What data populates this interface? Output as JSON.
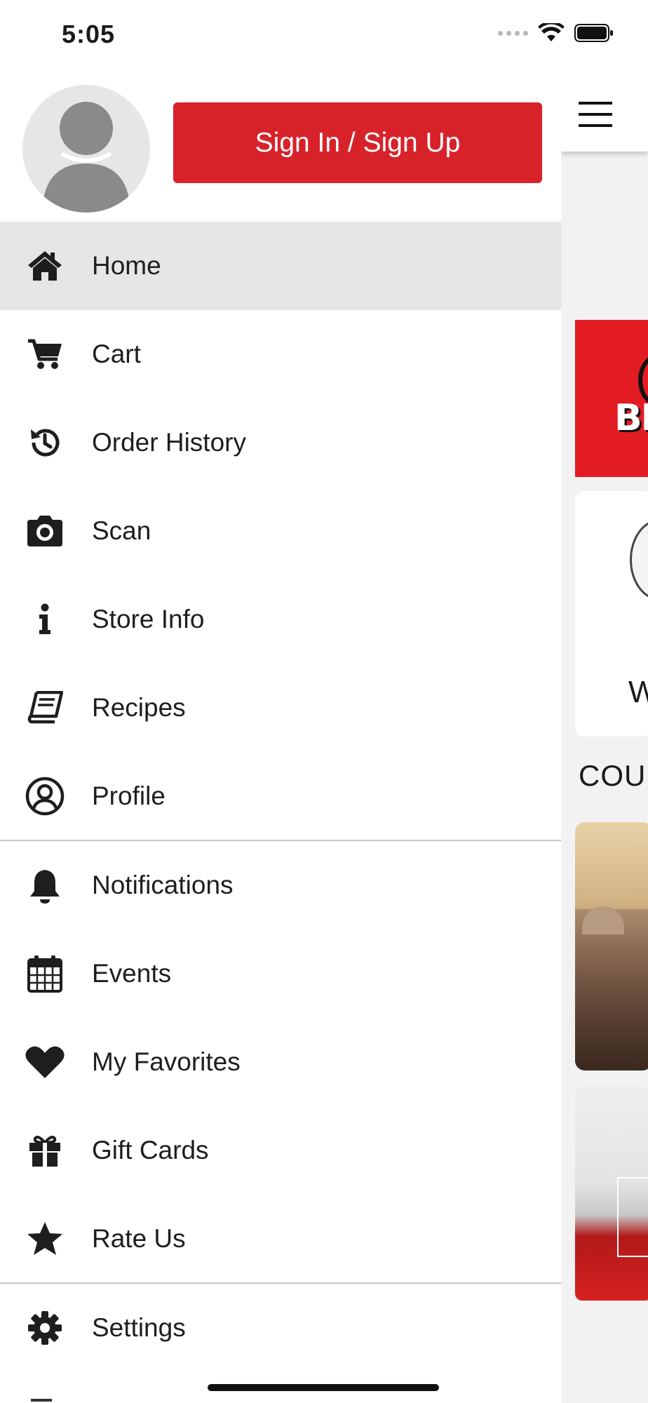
{
  "status_bar": {
    "time": "5:05"
  },
  "drawer": {
    "sign_in_label": "Sign In / Sign Up",
    "menu": [
      {
        "label": "Home",
        "icon": "home-icon",
        "active": true
      },
      {
        "label": "Cart",
        "icon": "cart-icon"
      },
      {
        "label": "Order History",
        "icon": "history-icon"
      },
      {
        "label": "Scan",
        "icon": "camera-icon"
      },
      {
        "label": "Store Info",
        "icon": "info-icon"
      },
      {
        "label": "Recipes",
        "icon": "book-icon"
      },
      {
        "label": "Profile",
        "icon": "user-circle-icon"
      },
      {
        "label": "Notifications",
        "icon": "bell-icon"
      },
      {
        "label": "Events",
        "icon": "calendar-icon"
      },
      {
        "label": "My Favorites",
        "icon": "heart-icon"
      },
      {
        "label": "Gift Cards",
        "icon": "gift-icon"
      },
      {
        "label": "Rate Us",
        "icon": "star-icon"
      },
      {
        "label": "Settings",
        "icon": "gear-icon"
      }
    ]
  },
  "main": {
    "promo_text": "BE",
    "welcome_letter": "W",
    "section_title": "COU"
  },
  "colors": {
    "accent": "#d8222a",
    "active_row": "#e6e6e6",
    "icon": "#1e1e1e"
  }
}
